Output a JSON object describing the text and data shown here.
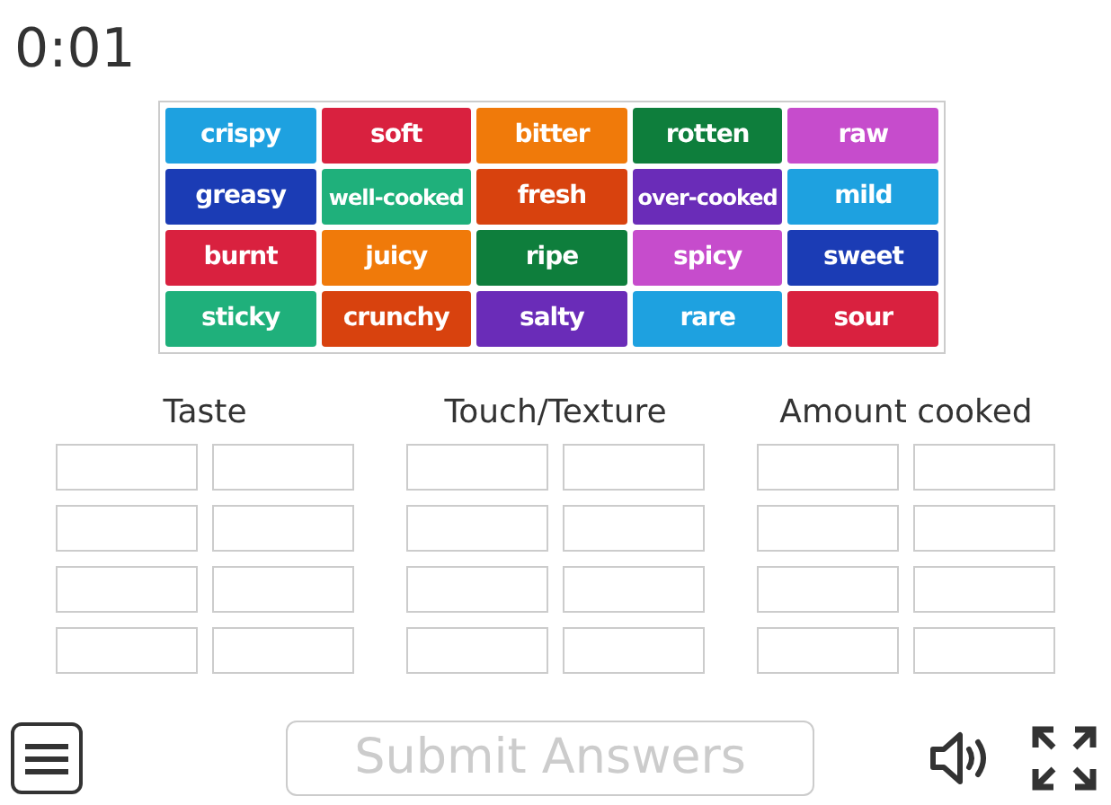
{
  "timer": "0:01",
  "tiles": [
    {
      "label": "crispy",
      "color": "#1ea1e0"
    },
    {
      "label": "soft",
      "color": "#d9213f"
    },
    {
      "label": "bitter",
      "color": "#f07a0a"
    },
    {
      "label": "rotten",
      "color": "#0e7e3c"
    },
    {
      "label": "raw",
      "color": "#c64ccc"
    },
    {
      "label": "greasy",
      "color": "#1b3cb5"
    },
    {
      "label": "well-cooked",
      "color": "#1fb07b"
    },
    {
      "label": "fresh",
      "color": "#d8420e"
    },
    {
      "label": "over-cooked",
      "color": "#6a2cb8"
    },
    {
      "label": "mild",
      "color": "#1ea1e0"
    },
    {
      "label": "burnt",
      "color": "#d9213f"
    },
    {
      "label": "juicy",
      "color": "#f07a0a"
    },
    {
      "label": "ripe",
      "color": "#0e7e3c"
    },
    {
      "label": "spicy",
      "color": "#c64ccc"
    },
    {
      "label": "sweet",
      "color": "#1b3cb5"
    },
    {
      "label": "sticky",
      "color": "#1fb07b"
    },
    {
      "label": "crunchy",
      "color": "#d8420e"
    },
    {
      "label": "salty",
      "color": "#6a2cb8"
    },
    {
      "label": "rare",
      "color": "#1ea1e0"
    },
    {
      "label": "sour",
      "color": "#d9213f"
    }
  ],
  "categories": [
    {
      "title": "Taste"
    },
    {
      "title": "Touch/Texture"
    },
    {
      "title": "Amount cooked"
    }
  ],
  "submit_button": {
    "label": "Submit Answers",
    "disabled": true
  }
}
